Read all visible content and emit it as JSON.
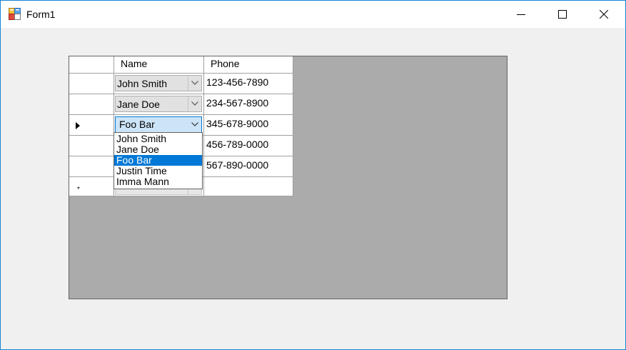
{
  "window": {
    "title": "Form1",
    "controls": {
      "minimize": "minimize",
      "maximize": "maximize",
      "close": "close"
    }
  },
  "grid": {
    "columns": [
      "Name",
      "Phone"
    ],
    "rows": [
      {
        "name": "John Smith",
        "phone": "123-456-7890",
        "current": false
      },
      {
        "name": "Jane Doe",
        "phone": "234-567-8900",
        "current": false
      },
      {
        "name": "Foo Bar",
        "phone": "345-678-9000",
        "current": true
      },
      {
        "name": "",
        "phone": "456-789-0000",
        "current": false
      },
      {
        "name": "",
        "phone": "567-890-0000",
        "current": false
      }
    ],
    "new_row_marker": "*",
    "current_row_marker": "▶"
  },
  "dropdown": {
    "options": [
      "John Smith",
      "Jane Doe",
      "Foo Bar",
      "Justin Time",
      "Imma Mann"
    ],
    "selected_index": 2
  },
  "colors": {
    "selection": "#0078d7",
    "grid_background": "#ababab",
    "window_border": "#1883d7"
  }
}
